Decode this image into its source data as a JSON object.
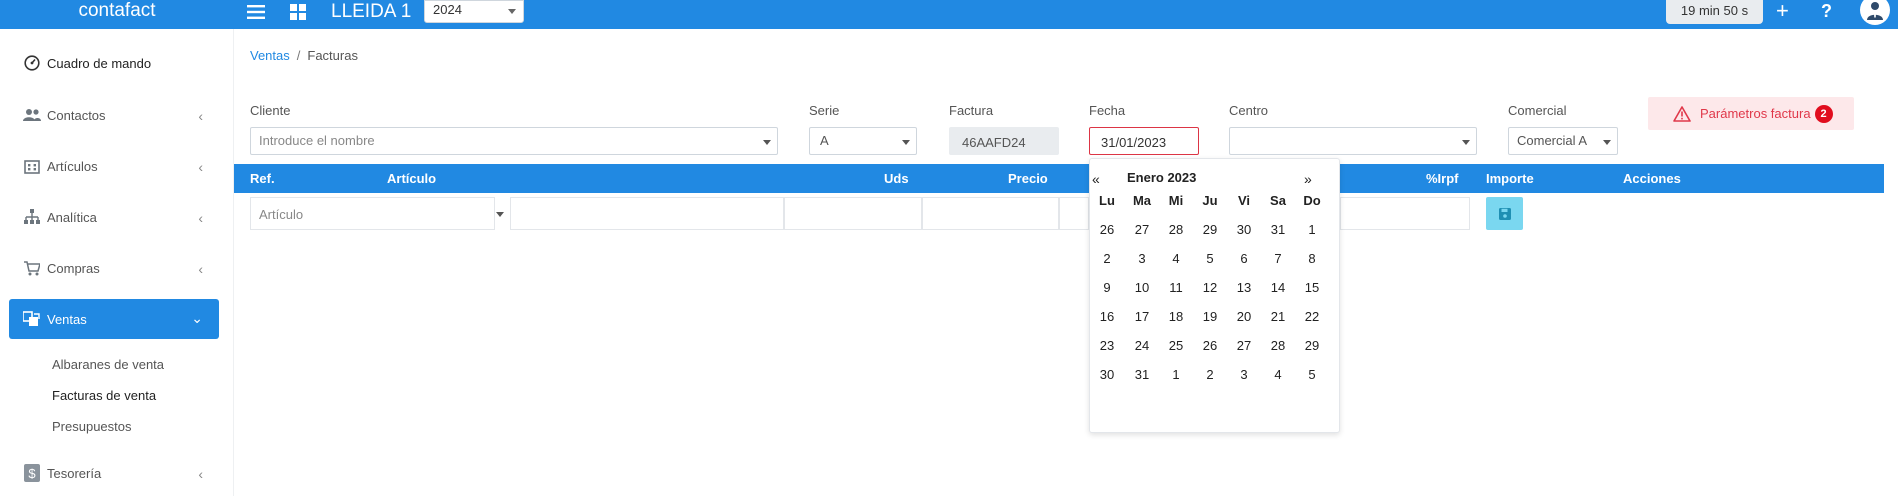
{
  "app": {
    "brand": "contafact",
    "company": "LLEIDA 1",
    "year": "2024",
    "timer": "19 min 50 s"
  },
  "topbar": {
    "plus_label": "+",
    "help_label": "?"
  },
  "sidebar": {
    "items": [
      {
        "label": "Cuadro de mando",
        "icon": "dashboard-icon"
      },
      {
        "label": "Contactos",
        "icon": "users-icon"
      },
      {
        "label": "Artículos",
        "icon": "building-icon"
      },
      {
        "label": "Analítica",
        "icon": "sitemap-icon"
      },
      {
        "label": "Compras",
        "icon": "cart-icon"
      },
      {
        "label": "Ventas",
        "icon": "sales-icon"
      },
      {
        "label": "Tesorería",
        "icon": "dollar-icon"
      }
    ],
    "ventas_sub": [
      "Albaranes de venta",
      "Facturas de venta",
      "Presupuestos"
    ]
  },
  "breadcrumb": {
    "parent": "Ventas",
    "current": "Facturas",
    "separator": "/"
  },
  "form": {
    "cliente_label": "Cliente",
    "cliente_placeholder": "Introduce el nombre",
    "serie_label": "Serie",
    "serie_value": "A",
    "factura_label": "Factura",
    "factura_value": "46AAFD24",
    "fecha_label": "Fecha",
    "fecha_value": "31/01/2023",
    "centro_label": "Centro",
    "centro_value": "",
    "comercial_label": "Comercial",
    "comercial_value": "Comercial A",
    "params_label": "Parámetros factura",
    "params_count": "2"
  },
  "table": {
    "headers": {
      "ref": "Ref.",
      "articulo": "Artículo",
      "uds": "Uds",
      "precio": "Precio",
      "irpf": "%Irpf",
      "importe": "Importe",
      "acciones": "Acciones"
    },
    "articulo_placeholder": "Artículo"
  },
  "datepicker": {
    "prev": "«",
    "next": "»",
    "title": "Enero 2023",
    "weekdays": [
      "Lu",
      "Ma",
      "Mi",
      "Ju",
      "Vi",
      "Sa",
      "Do"
    ],
    "weeks": [
      [
        "26",
        "27",
        "28",
        "29",
        "30",
        "31",
        "1"
      ],
      [
        "2",
        "3",
        "4",
        "5",
        "6",
        "7",
        "8"
      ],
      [
        "9",
        "10",
        "11",
        "12",
        "13",
        "14",
        "15"
      ],
      [
        "16",
        "17",
        "18",
        "19",
        "20",
        "21",
        "22"
      ],
      [
        "23",
        "24",
        "25",
        "26",
        "27",
        "28",
        "29"
      ],
      [
        "30",
        "31",
        "1",
        "2",
        "3",
        "4",
        "5"
      ]
    ]
  },
  "colors": {
    "primary": "#2189e2",
    "danger": "#e0384a",
    "danger_bg": "#fde8ea",
    "badge": "#e10d1e",
    "save": "#7ad7f0"
  }
}
